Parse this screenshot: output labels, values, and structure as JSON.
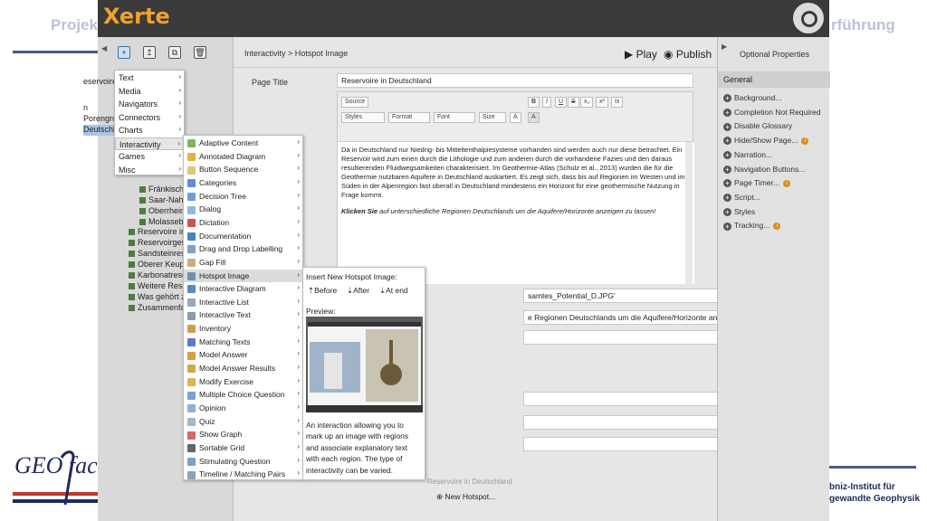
{
  "slide": {
    "title_left": "Projek",
    "title_right": "rführung",
    "logo_text": "GEO fac",
    "leibniz_line1": "bniz-Institut für",
    "leibniz_line2": "gewandte Geophysik"
  },
  "app": {
    "logo": "Xerte",
    "breadcrumb": "Interactivity > Hotspot Image",
    "play_label": "Play",
    "publish_label": "Publish"
  },
  "tree": [
    {
      "label": "eservoireiger",
      "selected": false
    },
    {
      "label": "n",
      "selected": false
    },
    {
      "label": "Porengrundw",
      "selected": false
    },
    {
      "label": "Deutschland",
      "selected": true
    },
    {
      "label": "Fränkische",
      "selected": false
    },
    {
      "label": "Saar-Nahe",
      "selected": false
    },
    {
      "label": "Oberrhein",
      "selected": false
    },
    {
      "label": "Molassebe",
      "selected": false
    },
    {
      "label": "Reservoire in",
      "selected": false
    },
    {
      "label": "Reservoirgest",
      "selected": false
    },
    {
      "label": "Sandsteinrese",
      "selected": false
    },
    {
      "label": "Oberer Keupe",
      "selected": false
    },
    {
      "label": "Karbonatrese",
      "selected": false
    },
    {
      "label": "Weitere Reser",
      "selected": false
    },
    {
      "label": "Was gehört zu",
      "selected": false
    },
    {
      "label": "Zusammenfas",
      "selected": false
    }
  ],
  "page_title_label": "Page Title",
  "page_title_value": "Reservoire in Deutschland",
  "editor": {
    "toolbar_row1": [
      "Source",
      "B",
      "I",
      "U",
      "S",
      "x₂",
      "x²",
      "Ix"
    ],
    "toolbar_row2": [
      "Styles",
      "Format",
      "Font",
      "Size",
      "A",
      "A"
    ],
    "body_p1": "Da in Deutschland nur Niedrig- bis Mitteltenthalpiesysteme vorhanden sind werden auch nur diese betrachtet. Ein Reservoir wird zum einen durch die Lithologie und zum anderen durch die vorhandene Fazies und den daraus resultierenden Fluidwegsamkeiten charakterisiert. Im Geothermie-Atlas (Schulz et al., 2013) wurden die für die Geothermie nutzbaren Aquifere in Deutschland auskartiert. Es zeigt sich, dass bis auf Regionen im Westen und im Süden in der Alpenregion fast überall in Deutschland mindestens ein Horizont für eine geothermische Nutzung in Frage kommt.",
    "body_p2_bold": "Klicken Sie",
    "body_p2_rest": " auf unterschiedliche Regionen Deutschlands um die Aquifere/Horizonte anzeigen zu lassen!"
  },
  "file_field_value": "samtes_Potential_D.JPG'",
  "instruction_field_value": "e Regionen Deutschlands um die Aquifere/Horizonte anzeigen zu lassen.",
  "bottom": {
    "hotspot_label": "New Hotspot...",
    "faded_label": "Reservoire in Deutschland"
  },
  "right_panel": {
    "title": "Optional Properties",
    "section": "General",
    "items": [
      {
        "label": "Background...",
        "info": false
      },
      {
        "label": "Completion Not Required",
        "info": false
      },
      {
        "label": "Disable Glossary",
        "info": false
      },
      {
        "label": "Hide/Show Page...",
        "info": true
      },
      {
        "label": "Narration...",
        "info": false
      },
      {
        "label": "Navigation Buttons...",
        "info": false
      },
      {
        "label": "Page Timer...",
        "info": true
      },
      {
        "label": "Script...",
        "info": false
      },
      {
        "label": "Styles",
        "info": false
      },
      {
        "label": "Tracking...",
        "info": true
      }
    ]
  },
  "menu1": [
    {
      "label": "Text",
      "active": false
    },
    {
      "label": "Media",
      "active": false
    },
    {
      "label": "Navigators",
      "active": false
    },
    {
      "label": "Connectors",
      "active": false
    },
    {
      "label": "Charts",
      "active": false
    },
    {
      "label": "Interactivity",
      "active": true
    },
    {
      "label": "Games",
      "active": false
    },
    {
      "label": "Misc",
      "active": false
    }
  ],
  "menu2": [
    {
      "label": "Adaptive Content",
      "color": "#7bb661"
    },
    {
      "label": "Annotated Diagram",
      "color": "#e3b341"
    },
    {
      "label": "Button Sequence",
      "color": "#e8c27a"
    },
    {
      "label": "Categories",
      "color": "#5b8fd1"
    },
    {
      "label": "Decision Tree",
      "color": "#6aa0d8"
    },
    {
      "label": "Dialog",
      "color": "#8fb7e2"
    },
    {
      "label": "Dictation",
      "color": "#d05050"
    },
    {
      "label": "Documentation",
      "color": "#4f7fbf"
    },
    {
      "label": "Drag and Drop Labelling",
      "color": "#7f9fcf"
    },
    {
      "label": "Gap Fill",
      "color": "#c9b07a"
    },
    {
      "label": "Hotspot Image",
      "color": "#6a8fb8"
    },
    {
      "label": "Interactive Diagram",
      "color": "#5f89c0"
    },
    {
      "label": "Interactive List",
      "color": "#9aa8b8"
    },
    {
      "label": "Interactive Text",
      "color": "#8a9ab0"
    },
    {
      "label": "Inventory",
      "color": "#c8a050"
    },
    {
      "label": "Matching Texts",
      "color": "#5e7bc8"
    },
    {
      "label": "Model Answer",
      "color": "#d8a040"
    },
    {
      "label": "Model Answer Results",
      "color": "#d0a848"
    },
    {
      "label": "Modify Exercise",
      "color": "#e0b450"
    },
    {
      "label": "Multiple Choice Question",
      "color": "#7fa0c8"
    },
    {
      "label": "Opinion",
      "color": "#8fb0d0"
    },
    {
      "label": "Quiz",
      "color": "#a0b8d0"
    },
    {
      "label": "Show Graph",
      "color": "#d06a6a"
    },
    {
      "label": "Sortable Grid",
      "color": "#666666"
    },
    {
      "label": "Stimulating Question",
      "color": "#7f9fcf"
    },
    {
      "label": "Timeline / Matching Pairs",
      "color": "#8fa0b8"
    }
  ],
  "menu2_active_index": 10,
  "menu3": {
    "title": "Insert New Hotspot Image:",
    "before_label": "Before",
    "after_label": "After",
    "at_end_label": "At end",
    "preview_label": "Preview:",
    "description": "An interaction allowing you to mark up an image with regions and associate explanatory text with each region. The type of interactivity can be varied."
  },
  "colors": {
    "topbar": "#3a3a3a",
    "logo": "#f0a22b",
    "selected": "#aac4e3"
  }
}
